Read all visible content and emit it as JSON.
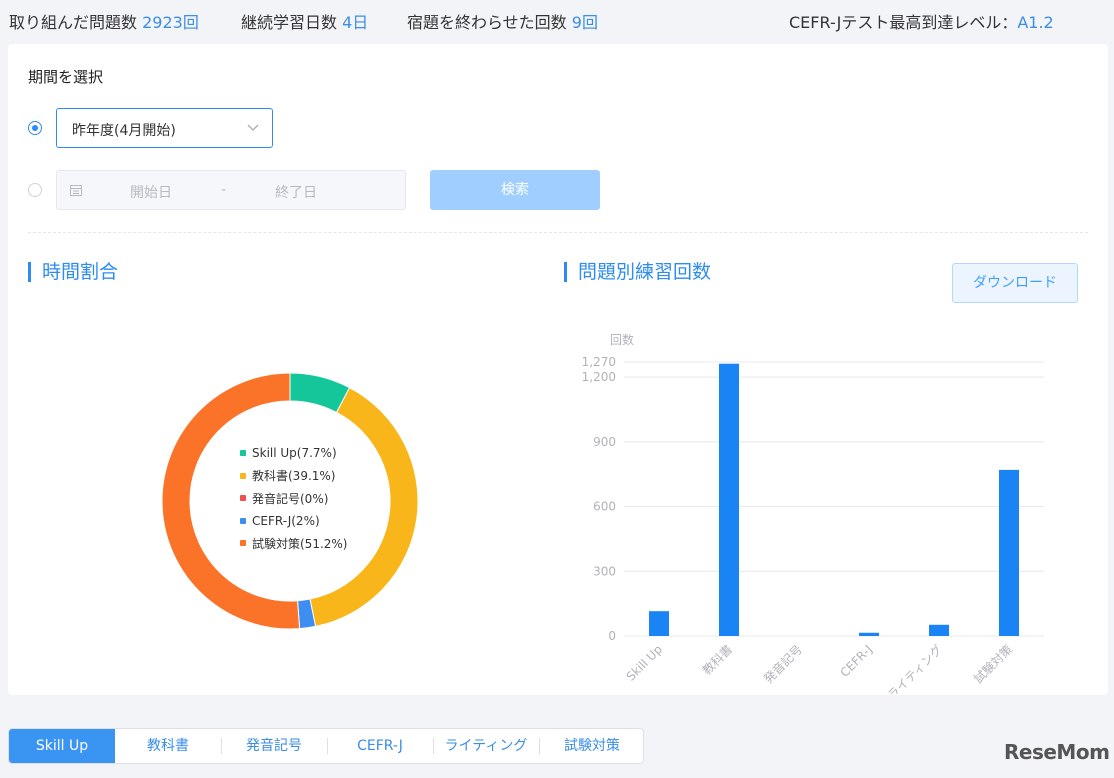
{
  "stats": {
    "problems_label": "取り組んだ問題数",
    "problems_value": "2923回",
    "streak_label": "継続学習日数",
    "streak_value": "4日",
    "homework_label": "宿題を終わらせた回数",
    "homework_value": "9回",
    "cefr_label": "CEFR-Jテスト最高到達レベル：",
    "cefr_value": "A1.2"
  },
  "period": {
    "title": "期間を選択",
    "selected_option": "昨年度(4月開始)",
    "start_placeholder": "開始日",
    "separator": "-",
    "end_placeholder": "終了日",
    "search_label": "検索"
  },
  "sections": {
    "time_ratio_title": "時間割合",
    "practice_count_title": "問題別練習回数",
    "download_label": "ダウンロード"
  },
  "colors": {
    "skill_up": "#13c79a",
    "textbook": "#f8b61a",
    "pronunciation": "#f05050",
    "cefr": "#3d8ef0",
    "exam": "#fa7328",
    "bar": "#1a84f5",
    "accent": "#2d8cf0"
  },
  "chart_data": [
    {
      "type": "pie",
      "labels": [
        "Skill Up(7.7%)",
        "教科書(39.1%)",
        "発音記号(0%)",
        "CEFR-J(2%)",
        "試験対策(51.2%)"
      ],
      "values": [
        7.7,
        39.1,
        0,
        2,
        51.2
      ]
    },
    {
      "type": "bar",
      "ylabel": "回数",
      "categories": [
        "Skill Up",
        "教科書",
        "発音記号",
        "CEFR-J",
        "ライティング",
        "試験対策"
      ],
      "values": [
        115,
        1262,
        0,
        15,
        52,
        770
      ],
      "yticks": [
        "0",
        "300",
        "600",
        "900",
        "1,200",
        "1,270"
      ],
      "ylim": [
        0,
        1270
      ]
    }
  ],
  "tabs": [
    "Skill Up",
    "教科書",
    "発音記号",
    "CEFR-J",
    "ライティング",
    "試験対策"
  ],
  "logo": "ReseMom"
}
